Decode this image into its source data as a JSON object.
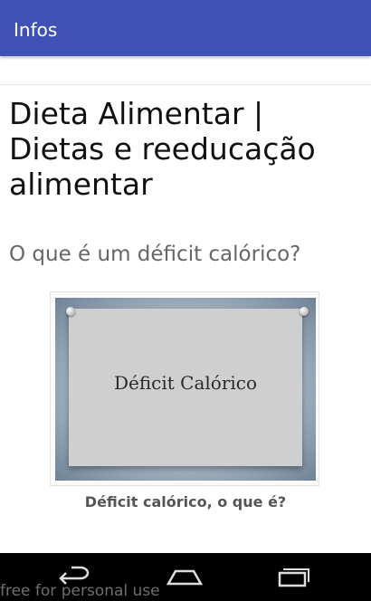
{
  "appbar": {
    "title": "Infos"
  },
  "article": {
    "title": "Dieta Alimentar | Dietas e reeducação alimentar",
    "subtitle": "O que é um déficit calórico?"
  },
  "figure": {
    "slide_text": "Déficit Calórico",
    "caption": "Déficit calórico, o que é?"
  },
  "navbar": {
    "icons": [
      "back-icon",
      "home-icon",
      "recent-apps-icon"
    ]
  },
  "watermark": "free for personal use",
  "colors": {
    "appbar": "#3f51b5",
    "navbar": "#000000",
    "title_text": "#111111",
    "subtitle_text": "#666666"
  }
}
